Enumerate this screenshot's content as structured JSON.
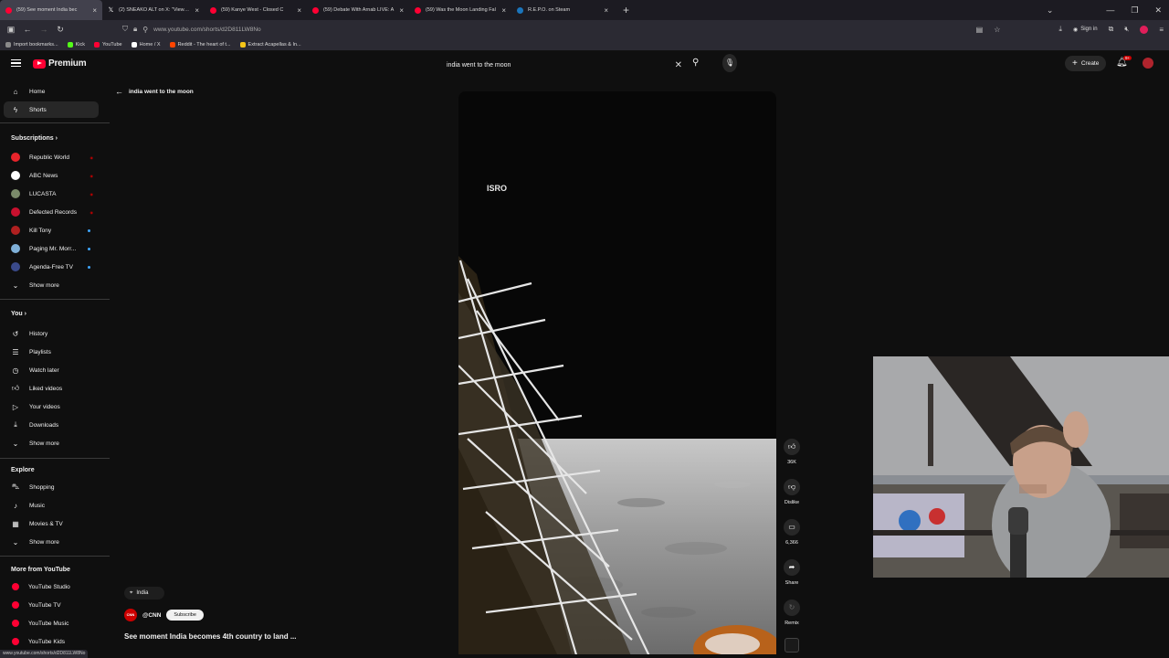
{
  "browser": {
    "tabs": [
      {
        "title": "(59) See moment India bec",
        "favicon": "youtube",
        "active": true
      },
      {
        "title": "(2) SNEAKO ALT on X: \"Viewbot",
        "favicon": "x",
        "active": false
      },
      {
        "title": "(59) Kanye West - Closed C",
        "favicon": "youtube",
        "active": false
      },
      {
        "title": "(59) Debate With Arnab LIVE: A",
        "favicon": "youtube",
        "active": false
      },
      {
        "title": "(59) Was the Moon Landing Fal",
        "favicon": "youtube",
        "active": false
      },
      {
        "title": "R.E.P.O. on Steam",
        "favicon": "steam",
        "active": false
      }
    ],
    "url": "www.youtube.com/shorts/d2D811LW8No",
    "signin_label": "Sign in",
    "bookmarks": [
      {
        "label": "Import bookmarks...",
        "color": "#8a8a8a"
      },
      {
        "label": "Kick",
        "color": "#53fc18"
      },
      {
        "label": "YouTube",
        "color": "#ff0033"
      },
      {
        "label": "Home / X",
        "color": "#ffffff"
      },
      {
        "label": "Reddit - The heart of t...",
        "color": "#ff4500"
      },
      {
        "label": "Extract Acapellas & In...",
        "color": "#f5c518"
      }
    ],
    "status_url": "www.youtube.com/shorts/d2D811LW8No"
  },
  "header": {
    "logo_text": "Premium",
    "search_value": "india went to the moon",
    "create_label": "Create",
    "notif_count": "9+"
  },
  "sidebar": {
    "main": [
      {
        "label": "Home",
        "icon": "home-icon"
      },
      {
        "label": "Shorts",
        "icon": "shorts-icon"
      }
    ],
    "subscriptions_heading": "Subscriptions",
    "subscriptions": [
      {
        "label": "Republic World",
        "color": "#e8242b",
        "badge": "live"
      },
      {
        "label": "ABC News",
        "color": "#ffffff",
        "badge": "live"
      },
      {
        "label": "LUCASTA",
        "color": "#7a8a6a",
        "badge": "live"
      },
      {
        "label": "Defected Records",
        "color": "#c8102e",
        "badge": "live"
      },
      {
        "label": "Kill Tony",
        "color": "#b02020",
        "badge": "dot"
      },
      {
        "label": "Paging Mr. Morr...",
        "color": "#7fb0d8",
        "badge": "dot"
      },
      {
        "label": "Agenda-Free TV",
        "color": "#3a4a8a",
        "badge": "dot"
      }
    ],
    "show_more": "Show more",
    "you_heading": "You",
    "you_items": [
      {
        "label": "History",
        "icon": "history-icon"
      },
      {
        "label": "Playlists",
        "icon": "playlists-icon"
      },
      {
        "label": "Watch later",
        "icon": "watch-later-icon"
      },
      {
        "label": "Liked videos",
        "icon": "like-icon"
      },
      {
        "label": "Your videos",
        "icon": "your-videos-icon"
      },
      {
        "label": "Downloads",
        "icon": "download-icon"
      }
    ],
    "explore_heading": "Explore",
    "explore_items": [
      {
        "label": "Shopping",
        "icon": "shopping-icon"
      },
      {
        "label": "Music",
        "icon": "music-icon"
      },
      {
        "label": "Movies & TV",
        "icon": "movies-icon"
      }
    ],
    "more_heading": "More from YouTube",
    "more_items": [
      {
        "label": "YouTube Studio"
      },
      {
        "label": "YouTube TV"
      },
      {
        "label": "YouTube Music"
      },
      {
        "label": "YouTube Kids"
      }
    ]
  },
  "page": {
    "back_label": "india went to the moon"
  },
  "video": {
    "overlay_text": "ISRO",
    "location": "India",
    "channel": "@CNN",
    "subscribe_label": "Subscribe",
    "title": "See moment India becomes 4th country to land ...",
    "likes": "36K",
    "dislike_label": "Dislike",
    "comments": "6,366",
    "share_label": "Share",
    "remix_label": "Remix"
  }
}
